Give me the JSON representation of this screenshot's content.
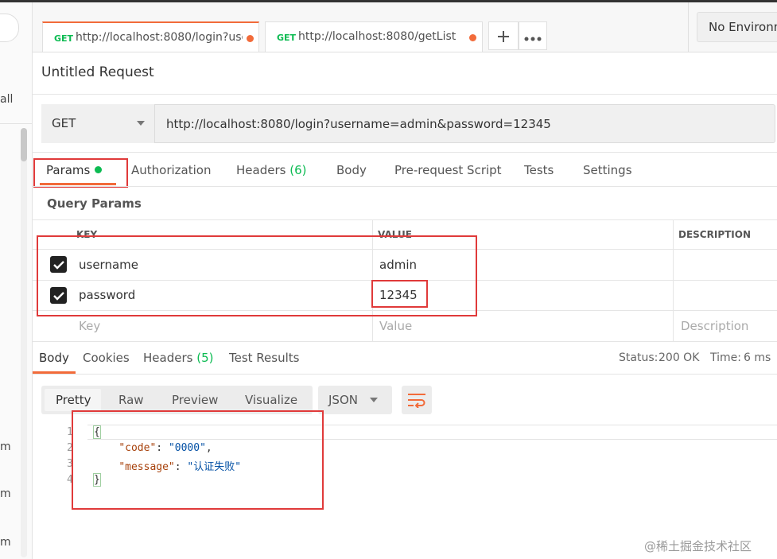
{
  "tabs": [
    {
      "method": "GET",
      "url": "http://localhost:8080/login?use..."
    },
    {
      "method": "GET",
      "url": "http://localhost:8080/getList"
    }
  ],
  "environment": "No Environment",
  "request": {
    "title": "Untitled Request",
    "method": "GET",
    "url": "http://localhost:8080/login?username=admin&password=12345",
    "tabs": {
      "params": "Params",
      "authorization": "Authorization",
      "headers": "Headers",
      "headers_count": "(6)",
      "body": "Body",
      "prerequest": "Pre-request Script",
      "tests": "Tests",
      "settings": "Settings"
    }
  },
  "query_params": {
    "title": "Query Params",
    "columns": {
      "key": "KEY",
      "value": "VALUE",
      "description": "DESCRIPTION"
    },
    "rows": [
      {
        "checked": true,
        "key": "username",
        "value": "admin"
      },
      {
        "checked": true,
        "key": "password",
        "value": "12345"
      }
    ],
    "placeholders": {
      "key": "Key",
      "value": "Value",
      "description": "Description"
    }
  },
  "response": {
    "tabs": {
      "body": "Body",
      "cookies": "Cookies",
      "headers": "Headers",
      "headers_count": "(5)",
      "test_results": "Test Results"
    },
    "status_label": "Status:",
    "status_value": "200 OK",
    "time_label": "Time:",
    "time_value": "6 ms",
    "view_modes": [
      "Pretty",
      "Raw",
      "Preview",
      "Visualize"
    ],
    "format": "JSON",
    "code_lines": [
      "{",
      "    \"code\": \"0000\",",
      "    \"message\": \"认证失败\"",
      "}"
    ],
    "line_numbers": [
      "1",
      "2",
      "3",
      "4"
    ]
  },
  "sidebar": {
    "fragments": [
      "all",
      "m",
      "m",
      "m"
    ]
  },
  "watermark": "@稀土掘金技术社区",
  "colors": {
    "accent": "#f26b3a",
    "success": "#0cbb52",
    "highlight": "#e03a3a"
  }
}
